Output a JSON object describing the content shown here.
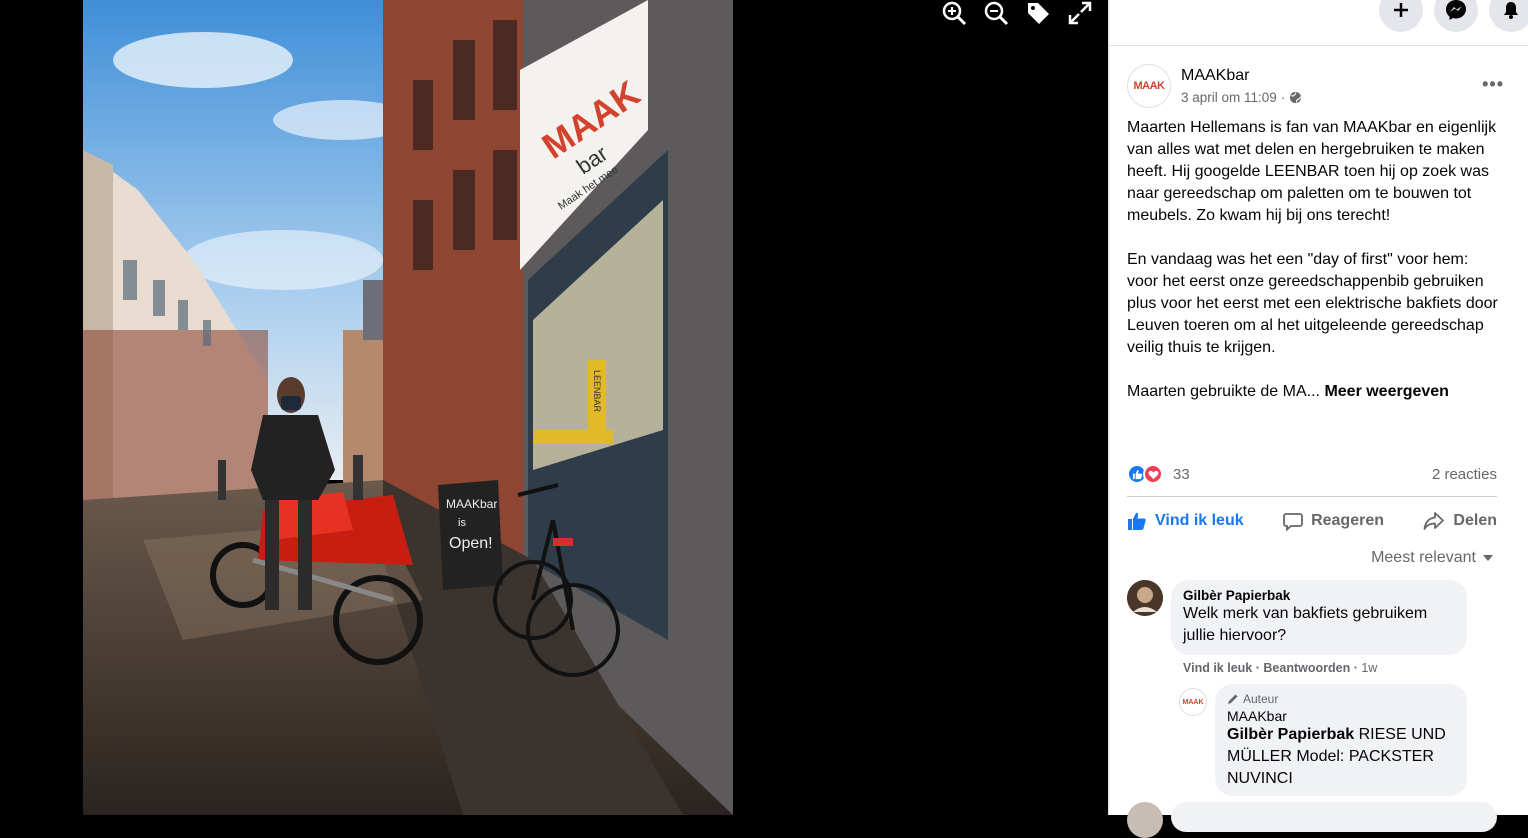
{
  "viewer": {
    "zoom_in": "zoom-in",
    "zoom_out": "zoom-out",
    "tag": "tag",
    "fullscreen": "fullscreen",
    "photo": {
      "sign_word": "bar",
      "sign_tagline": "Maak het mee",
      "chalkboard_brand": "MAAKbar",
      "chalkboard_line1": "is",
      "chalkboard_line2": "Open!",
      "banner_text": "LEENBAR"
    }
  },
  "topbar": {
    "create_icon": "plus-icon",
    "messenger_icon": "messenger-icon",
    "notifications_icon": "bell-icon"
  },
  "post": {
    "page_name": "MAAKbar",
    "logo_text": "MAAK",
    "timestamp": "3 april om 11:09",
    "separator": "·",
    "paragraph1": "Maarten Hellemans is fan van MAAKbar en eigenlijk van alles wat met delen en hergebruiken te maken heeft. Hij googelde LEENBAR toen hij op zoek was naar gereedschap om paletten om te bouwen tot meubels. Zo kwam hij bij ons terecht!",
    "paragraph2": "En vandaag was het een \"day of first\" voor hem: voor het eerst onze gereedschappenbib gebruiken plus voor het eerst met een elektrische bakfiets door Leuven toeren om al het uitgeleende gereedschap veilig thuis te krijgen.",
    "paragraph3": "Maarten gebruikte de MA...",
    "see_more": "Meer weergeven",
    "reaction_count": "33",
    "comment_count": "2 reacties"
  },
  "actions": {
    "like": "Vind ik leuk",
    "comment": "Reageren",
    "share": "Delen"
  },
  "sort_label": "Meest relevant",
  "comments": [
    {
      "name": "Gilbèr Papierbak",
      "text": "Welk merk van bakfiets gebruikem jullie hiervoor?",
      "like": "Vind ik leuk",
      "reply": "Beantwoorden",
      "time": "1w",
      "sep": "·"
    }
  ],
  "reply": {
    "badge": "Auteur",
    "name": "MAAKbar",
    "mention": "Gilbèr Papierbak",
    "text": "RIESE UND MÜLLER Model: PACKSTER NUVINCI"
  },
  "colors": {
    "accent": "#1877f2",
    "love": "#f33e58",
    "secondary_text": "#65676b"
  }
}
